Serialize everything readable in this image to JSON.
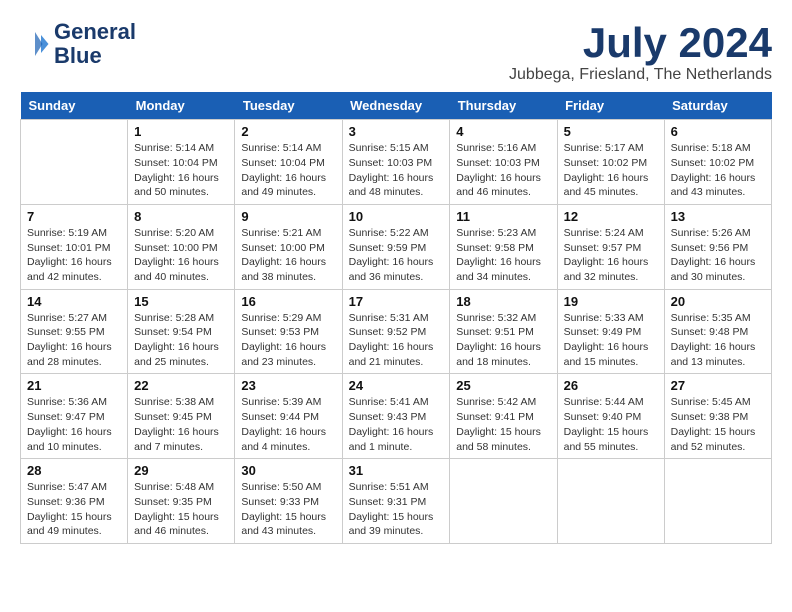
{
  "header": {
    "logo_line1": "General",
    "logo_line2": "Blue",
    "title": "July 2024",
    "subtitle": "Jubbega, Friesland, The Netherlands"
  },
  "days_of_week": [
    "Sunday",
    "Monday",
    "Tuesday",
    "Wednesday",
    "Thursday",
    "Friday",
    "Saturday"
  ],
  "weeks": [
    [
      {
        "day": "",
        "text": ""
      },
      {
        "day": "1",
        "text": "Sunrise: 5:14 AM\nSunset: 10:04 PM\nDaylight: 16 hours\nand 50 minutes."
      },
      {
        "day": "2",
        "text": "Sunrise: 5:14 AM\nSunset: 10:04 PM\nDaylight: 16 hours\nand 49 minutes."
      },
      {
        "day": "3",
        "text": "Sunrise: 5:15 AM\nSunset: 10:03 PM\nDaylight: 16 hours\nand 48 minutes."
      },
      {
        "day": "4",
        "text": "Sunrise: 5:16 AM\nSunset: 10:03 PM\nDaylight: 16 hours\nand 46 minutes."
      },
      {
        "day": "5",
        "text": "Sunrise: 5:17 AM\nSunset: 10:02 PM\nDaylight: 16 hours\nand 45 minutes."
      },
      {
        "day": "6",
        "text": "Sunrise: 5:18 AM\nSunset: 10:02 PM\nDaylight: 16 hours\nand 43 minutes."
      }
    ],
    [
      {
        "day": "7",
        "text": "Sunrise: 5:19 AM\nSunset: 10:01 PM\nDaylight: 16 hours\nand 42 minutes."
      },
      {
        "day": "8",
        "text": "Sunrise: 5:20 AM\nSunset: 10:00 PM\nDaylight: 16 hours\nand 40 minutes."
      },
      {
        "day": "9",
        "text": "Sunrise: 5:21 AM\nSunset: 10:00 PM\nDaylight: 16 hours\nand 38 minutes."
      },
      {
        "day": "10",
        "text": "Sunrise: 5:22 AM\nSunset: 9:59 PM\nDaylight: 16 hours\nand 36 minutes."
      },
      {
        "day": "11",
        "text": "Sunrise: 5:23 AM\nSunset: 9:58 PM\nDaylight: 16 hours\nand 34 minutes."
      },
      {
        "day": "12",
        "text": "Sunrise: 5:24 AM\nSunset: 9:57 PM\nDaylight: 16 hours\nand 32 minutes."
      },
      {
        "day": "13",
        "text": "Sunrise: 5:26 AM\nSunset: 9:56 PM\nDaylight: 16 hours\nand 30 minutes."
      }
    ],
    [
      {
        "day": "14",
        "text": "Sunrise: 5:27 AM\nSunset: 9:55 PM\nDaylight: 16 hours\nand 28 minutes."
      },
      {
        "day": "15",
        "text": "Sunrise: 5:28 AM\nSunset: 9:54 PM\nDaylight: 16 hours\nand 25 minutes."
      },
      {
        "day": "16",
        "text": "Sunrise: 5:29 AM\nSunset: 9:53 PM\nDaylight: 16 hours\nand 23 minutes."
      },
      {
        "day": "17",
        "text": "Sunrise: 5:31 AM\nSunset: 9:52 PM\nDaylight: 16 hours\nand 21 minutes."
      },
      {
        "day": "18",
        "text": "Sunrise: 5:32 AM\nSunset: 9:51 PM\nDaylight: 16 hours\nand 18 minutes."
      },
      {
        "day": "19",
        "text": "Sunrise: 5:33 AM\nSunset: 9:49 PM\nDaylight: 16 hours\nand 15 minutes."
      },
      {
        "day": "20",
        "text": "Sunrise: 5:35 AM\nSunset: 9:48 PM\nDaylight: 16 hours\nand 13 minutes."
      }
    ],
    [
      {
        "day": "21",
        "text": "Sunrise: 5:36 AM\nSunset: 9:47 PM\nDaylight: 16 hours\nand 10 minutes."
      },
      {
        "day": "22",
        "text": "Sunrise: 5:38 AM\nSunset: 9:45 PM\nDaylight: 16 hours\nand 7 minutes."
      },
      {
        "day": "23",
        "text": "Sunrise: 5:39 AM\nSunset: 9:44 PM\nDaylight: 16 hours\nand 4 minutes."
      },
      {
        "day": "24",
        "text": "Sunrise: 5:41 AM\nSunset: 9:43 PM\nDaylight: 16 hours\nand 1 minute."
      },
      {
        "day": "25",
        "text": "Sunrise: 5:42 AM\nSunset: 9:41 PM\nDaylight: 15 hours\nand 58 minutes."
      },
      {
        "day": "26",
        "text": "Sunrise: 5:44 AM\nSunset: 9:40 PM\nDaylight: 15 hours\nand 55 minutes."
      },
      {
        "day": "27",
        "text": "Sunrise: 5:45 AM\nSunset: 9:38 PM\nDaylight: 15 hours\nand 52 minutes."
      }
    ],
    [
      {
        "day": "28",
        "text": "Sunrise: 5:47 AM\nSunset: 9:36 PM\nDaylight: 15 hours\nand 49 minutes."
      },
      {
        "day": "29",
        "text": "Sunrise: 5:48 AM\nSunset: 9:35 PM\nDaylight: 15 hours\nand 46 minutes."
      },
      {
        "day": "30",
        "text": "Sunrise: 5:50 AM\nSunset: 9:33 PM\nDaylight: 15 hours\nand 43 minutes."
      },
      {
        "day": "31",
        "text": "Sunrise: 5:51 AM\nSunset: 9:31 PM\nDaylight: 15 hours\nand 39 minutes."
      },
      {
        "day": "",
        "text": ""
      },
      {
        "day": "",
        "text": ""
      },
      {
        "day": "",
        "text": ""
      }
    ]
  ]
}
